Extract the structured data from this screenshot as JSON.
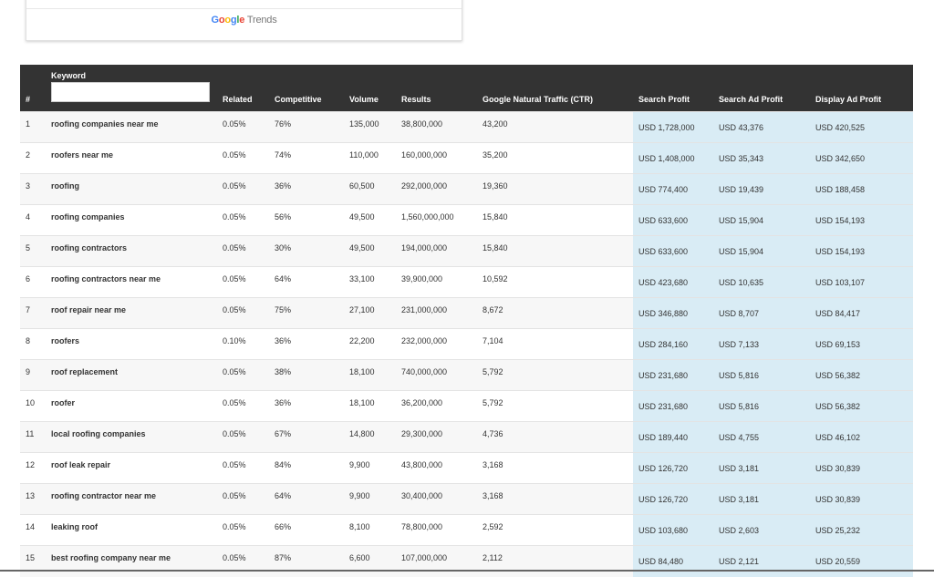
{
  "trends": {
    "logo_google": "Google",
    "logo_trends": "Trends"
  },
  "table": {
    "headers": {
      "index": "#",
      "keyword": "Keyword",
      "related": "Related",
      "competitive": "Competitive",
      "volume": "Volume",
      "results": "Results",
      "traffic": "Google Natural Traffic (CTR)",
      "search_profit": "Search Profit",
      "search_ad_profit": "Search Ad Profit",
      "display_ad_profit": "Display Ad Profit"
    },
    "keyword_filter_value": "",
    "rows": [
      {
        "n": "1",
        "keyword": "roofing companies near me",
        "related": "0.05%",
        "competitive": "76%",
        "volume": "135,000",
        "results": "38,800,000",
        "traffic": "43,200",
        "search_profit": "USD 1,728,000",
        "search_ad_profit": "USD 43,376",
        "display_ad_profit": "USD 420,525"
      },
      {
        "n": "2",
        "keyword": "roofers near me",
        "related": "0.05%",
        "competitive": "74%",
        "volume": "110,000",
        "results": "160,000,000",
        "traffic": "35,200",
        "search_profit": "USD 1,408,000",
        "search_ad_profit": "USD 35,343",
        "display_ad_profit": "USD 342,650"
      },
      {
        "n": "3",
        "keyword": "roofing",
        "related": "0.05%",
        "competitive": "36%",
        "volume": "60,500",
        "results": "292,000,000",
        "traffic": "19,360",
        "search_profit": "USD 774,400",
        "search_ad_profit": "USD 19,439",
        "display_ad_profit": "USD 188,458"
      },
      {
        "n": "4",
        "keyword": "roofing companies",
        "related": "0.05%",
        "competitive": "56%",
        "volume": "49,500",
        "results": "1,560,000,000",
        "traffic": "15,840",
        "search_profit": "USD 633,600",
        "search_ad_profit": "USD 15,904",
        "display_ad_profit": "USD 154,193"
      },
      {
        "n": "5",
        "keyword": "roofing contractors",
        "related": "0.05%",
        "competitive": "30%",
        "volume": "49,500",
        "results": "194,000,000",
        "traffic": "15,840",
        "search_profit": "USD 633,600",
        "search_ad_profit": "USD 15,904",
        "display_ad_profit": "USD 154,193"
      },
      {
        "n": "6",
        "keyword": "roofing contractors near me",
        "related": "0.05%",
        "competitive": "64%",
        "volume": "33,100",
        "results": "39,900,000",
        "traffic": "10,592",
        "search_profit": "USD 423,680",
        "search_ad_profit": "USD 10,635",
        "display_ad_profit": "USD 103,107"
      },
      {
        "n": "7",
        "keyword": "roof repair near me",
        "related": "0.05%",
        "competitive": "75%",
        "volume": "27,100",
        "results": "231,000,000",
        "traffic": "8,672",
        "search_profit": "USD 346,880",
        "search_ad_profit": "USD 8,707",
        "display_ad_profit": "USD 84,417"
      },
      {
        "n": "8",
        "keyword": "roofers",
        "related": "0.10%",
        "competitive": "36%",
        "volume": "22,200",
        "results": "232,000,000",
        "traffic": "7,104",
        "search_profit": "USD 284,160",
        "search_ad_profit": "USD 7,133",
        "display_ad_profit": "USD 69,153"
      },
      {
        "n": "9",
        "keyword": "roof replacement",
        "related": "0.05%",
        "competitive": "38%",
        "volume": "18,100",
        "results": "740,000,000",
        "traffic": "5,792",
        "search_profit": "USD 231,680",
        "search_ad_profit": "USD 5,816",
        "display_ad_profit": "USD 56,382"
      },
      {
        "n": "10",
        "keyword": "roofer",
        "related": "0.05%",
        "competitive": "36%",
        "volume": "18,100",
        "results": "36,200,000",
        "traffic": "5,792",
        "search_profit": "USD 231,680",
        "search_ad_profit": "USD 5,816",
        "display_ad_profit": "USD 56,382"
      },
      {
        "n": "11",
        "keyword": "local roofing companies",
        "related": "0.05%",
        "competitive": "67%",
        "volume": "14,800",
        "results": "29,300,000",
        "traffic": "4,736",
        "search_profit": "USD 189,440",
        "search_ad_profit": "USD 4,755",
        "display_ad_profit": "USD 46,102"
      },
      {
        "n": "12",
        "keyword": "roof leak repair",
        "related": "0.05%",
        "competitive": "84%",
        "volume": "9,900",
        "results": "43,800,000",
        "traffic": "3,168",
        "search_profit": "USD 126,720",
        "search_ad_profit": "USD 3,181",
        "display_ad_profit": "USD 30,839"
      },
      {
        "n": "13",
        "keyword": "roofing contractor near me",
        "related": "0.05%",
        "competitive": "64%",
        "volume": "9,900",
        "results": "30,400,000",
        "traffic": "3,168",
        "search_profit": "USD 126,720",
        "search_ad_profit": "USD 3,181",
        "display_ad_profit": "USD 30,839"
      },
      {
        "n": "14",
        "keyword": "leaking roof",
        "related": "0.05%",
        "competitive": "66%",
        "volume": "8,100",
        "results": "78,800,000",
        "traffic": "2,592",
        "search_profit": "USD 103,680",
        "search_ad_profit": "USD 2,603",
        "display_ad_profit": "USD 25,232"
      },
      {
        "n": "15",
        "keyword": "best roofing company near me",
        "related": "0.05%",
        "competitive": "87%",
        "volume": "6,600",
        "results": "107,000,000",
        "traffic": "2,112",
        "search_profit": "USD 84,480",
        "search_ad_profit": "USD 2,121",
        "display_ad_profit": "USD 20,559"
      }
    ]
  },
  "colors": {
    "header_bg": "#333333",
    "profit_bg": "#d9ecf5",
    "row_alt_bg": "#f7f7f7"
  }
}
